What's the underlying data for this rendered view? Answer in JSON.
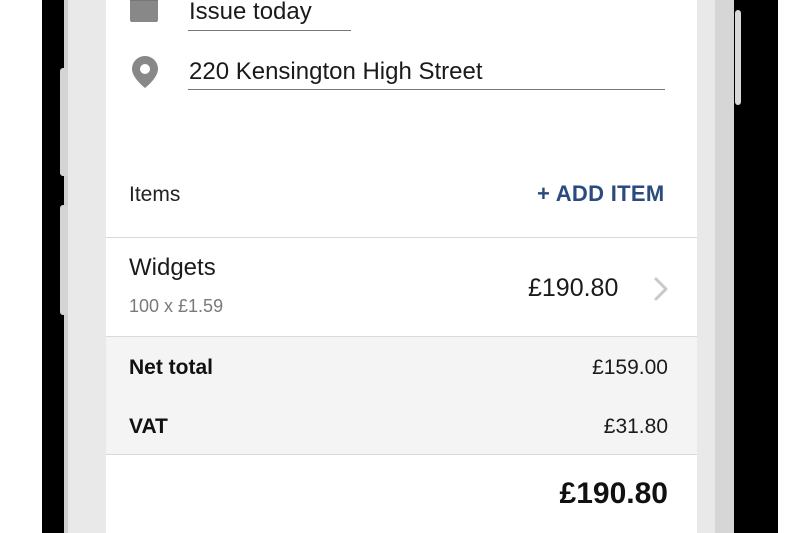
{
  "invoice": {
    "issue_date": "Issue today",
    "address": "220 Kensington High Street"
  },
  "items_section": {
    "label": "Items",
    "add_button": "+ ADD ITEM"
  },
  "items": [
    {
      "name": "Widgets",
      "detail": "100 x £1.59",
      "amount": "£190.80"
    }
  ],
  "totals": {
    "net_label": "Net total",
    "net_value": "£159.00",
    "vat_label": "VAT",
    "vat_value": "£31.80",
    "grand_total": "£190.80"
  },
  "colors": {
    "accent": "#2b4a7e",
    "icon": "#888888",
    "totals_bg": "#f4f4f4"
  },
  "icons": [
    "calendar-icon",
    "location-pin-icon",
    "chevron-right-icon"
  ]
}
